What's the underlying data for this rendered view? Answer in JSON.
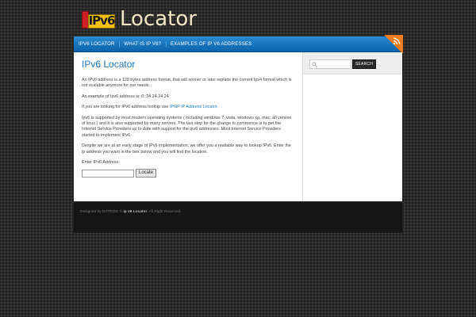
{
  "logo": {
    "badge": "IPv6",
    "title": "Locator"
  },
  "nav": {
    "items": [
      {
        "label": "IPv6 Locator"
      },
      {
        "label": "What is IP V6?"
      },
      {
        "label": "Examples of IP V6 addresses"
      }
    ],
    "separator": "|"
  },
  "rss": {
    "icon": "rss-icon",
    "color": "#f07b1c"
  },
  "content": {
    "title": "IPv6 Locator",
    "para1": "An IPv6 address is a 128 bytes address format, that will sooner or later replace the current Ipv4 format which is not scalable anymore for our needs.",
    "para2_prefix": "An example of Ipv6 address is: ",
    "para2_value": "0::24.24.24.24",
    "para3_prefix": "If you are looking for IPv6 address lookup use ",
    "para3_link": "IPGP IP Address Locator",
    "para3_suffix": ".",
    "para4": "Ipv6 is supported by most modern operating systems ( including windows 7, vista, windows xp, mac, all version of linux ) and it is also supported by many servers. The last step for the change to commence is to get the Internet Service Providers up to date with support for the ipv6 addresses. Most Internet Service Providers started to implement IPv6.",
    "para5": "Despite we are at an early stage of IPv6 implementation, we offer you a realiable way to lookup IPv6. Enter the ip address you want in the box below and you will find the location.",
    "form_label": "Enter IPv6 Address:",
    "input_value": "",
    "button_label": "Locate"
  },
  "sidebar": {
    "search_placeholder": "",
    "search_button": "Search",
    "search_icon": "search-icon"
  },
  "footer": {
    "prefix": "Designed by ",
    "designer": "DJTRIDS",
    "middle": " © ",
    "site": "ip v6 Locator",
    "suffix": ". All Right Reserved."
  },
  "colors": {
    "accent": "#1e7bc3",
    "nav": "#1a73bb",
    "background": "#2a2a2a"
  }
}
